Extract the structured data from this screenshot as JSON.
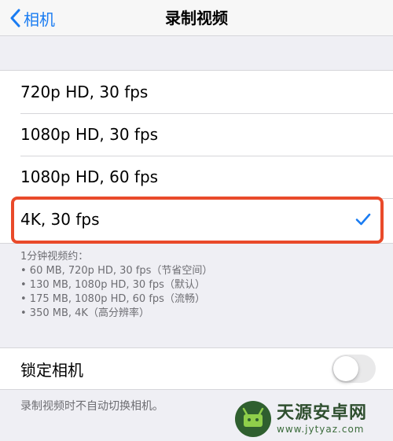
{
  "navbar": {
    "back_label": "相机",
    "title": "录制视频"
  },
  "options": [
    {
      "label": "720p HD, 30 fps",
      "selected": false
    },
    {
      "label": "1080p HD, 30 fps",
      "selected": false
    },
    {
      "label": "1080p HD, 60 fps",
      "selected": false
    },
    {
      "label": "4K, 30 fps",
      "selected": true
    }
  ],
  "footnote": {
    "heading": "1分钟视频约：",
    "lines": [
      "• 60 MB, 720p HD, 30 fps（节省空间）",
      "• 130 MB, 1080p HD, 30 fps（默认）",
      "• 175 MB, 1080p HD, 60 fps（流畅）",
      "• 350 MB, 4K（高分辨率）"
    ]
  },
  "lock_camera": {
    "label": "锁定相机",
    "enabled": false,
    "note": "录制视频时不自动切换相机。"
  },
  "watermark": {
    "title": "天源安卓网",
    "url": "www.jytyaz.com"
  },
  "colors": {
    "accent": "#1a7cf2",
    "highlight": "#e94a2a",
    "background": "#efeff4"
  },
  "icons": {
    "back": "chevron-left-icon",
    "check": "checkmark-icon"
  }
}
